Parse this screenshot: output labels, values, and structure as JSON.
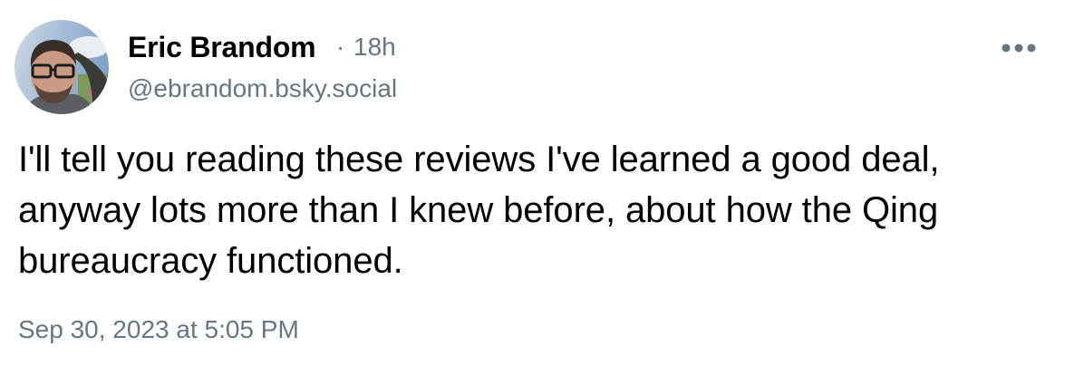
{
  "post": {
    "author": {
      "display_name": "Eric Brandom",
      "handle": "@ebrandom.bsky.social"
    },
    "meta_separator": "·",
    "age": "18h",
    "text": "I'll tell you reading these reviews I've learned a good deal, anyway lots more than I knew before, about how the Qing bureaucracy functioned.",
    "timestamp": "Sep 30, 2023 at 5:05 PM",
    "more_icon": "ellipsis-horizontal-icon"
  },
  "colors": {
    "text_primary": "#000000",
    "text_secondary": "#687684",
    "background": "#ffffff"
  }
}
